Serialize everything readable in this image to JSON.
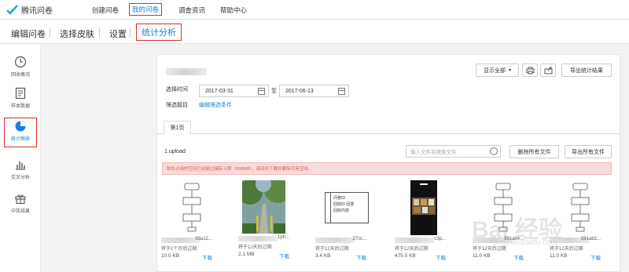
{
  "brand": {
    "name": "腾讯问卷"
  },
  "topnav": {
    "items": [
      {
        "label": "创建问卷"
      },
      {
        "label": "我的问卷"
      },
      {
        "label": "调查资讯"
      },
      {
        "label": "帮助中心"
      }
    ]
  },
  "subnav": {
    "items": [
      {
        "label": "编辑问卷"
      },
      {
        "label": "选择皮肤"
      },
      {
        "label": "设置"
      },
      {
        "label": "统计分析"
      }
    ]
  },
  "sidebar": {
    "items": [
      {
        "label": "回收概况",
        "icon": "clock-icon"
      },
      {
        "label": "样本数据",
        "icon": "document-icon"
      },
      {
        "label": "统计图表",
        "icon": "pie-chart-icon"
      },
      {
        "label": "交叉分析",
        "icon": "bar-chart-icon"
      },
      {
        "label": "中奖结果",
        "icon": "gift-icon"
      }
    ]
  },
  "toolbar": {
    "show_all": "显示全部",
    "export_stats": "导出统计结果"
  },
  "filters": {
    "time_label": "选择时间",
    "start_date": "2017-03-31",
    "to_label": "至",
    "end_date": "2017-06-13",
    "filter_label": "筛选题目",
    "edit_filter": "编辑筛选条件"
  },
  "tabs": [
    {
      "label": "第1页"
    }
  ],
  "upload": {
    "title": "1.upload",
    "search_placeholder": "输入文件名搜索文件",
    "delete_all": "删除所有文件",
    "export_all": "导出所有文件",
    "warning": "附件占用的空间已经超过储存上限（500MB），请及时下载并删除可用空间。"
  },
  "files": [
    {
      "name_tail": "93a12...",
      "expire": "将于1个月后过期",
      "size": "10.0 KB",
      "download": "下载",
      "thumb": "flowchart"
    },
    {
      "name_tail": "1ph...",
      "expire": "将于12天后过期",
      "size": "2.1 MB",
      "download": "下载",
      "thumb": "photo"
    },
    {
      "name_tail": "27cc...",
      "expire": "将于12天后过期",
      "size": "3.4 KB",
      "download": "下载",
      "thumb": "table"
    },
    {
      "name_tail": "c3p...",
      "expire": "将于12天后过期",
      "size": "475.5 KB",
      "download": "下载",
      "thumb": "phone"
    },
    {
      "name_tail": "591ab4...",
      "expire": "将于12天后过期",
      "size": "11.0 KB",
      "download": "下载",
      "thumb": "flowchart"
    },
    {
      "name_tail": "591ab2...",
      "expire": "将于12天后过期",
      "size": "11.0 KB",
      "download": "下载",
      "thumb": "flowchart"
    }
  ],
  "table_thumb": {
    "line1": "问卷ID",
    "line2": "回收ID  回答",
    "line3": "回收内容"
  },
  "watermark": {
    "main": "Bai 经验",
    "sub": "jingyan.baidu.com"
  },
  "colors": {
    "accent": "#1a7fd9",
    "highlight": "#e02b2b",
    "warning_bg": "#f8dcdc"
  }
}
